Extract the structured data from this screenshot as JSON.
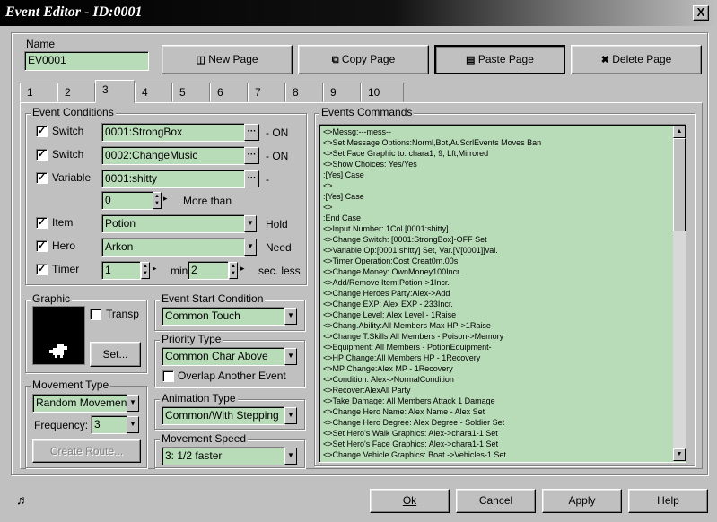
{
  "window": {
    "title": "Event Editor - ID:0001",
    "close_label": "X"
  },
  "name_field": {
    "label": "Name",
    "value": "EV0001"
  },
  "page_buttons": {
    "new_page": "New Page",
    "copy_page": "Copy Page",
    "paste_page": "Paste Page",
    "delete_page": "Delete Page"
  },
  "tabs": [
    "1",
    "2",
    "3",
    "4",
    "5",
    "6",
    "7",
    "8",
    "9",
    "10"
  ],
  "active_tab": "3",
  "event_conditions": {
    "label": "Event Conditions",
    "switch1": {
      "label": "Switch",
      "value": "0001:StrongBox",
      "suffix": "- ON"
    },
    "switch2": {
      "label": "Switch",
      "value": "0002:ChangeMusic",
      "suffix": "- ON"
    },
    "variable": {
      "label": "Variable",
      "value": "0001:shitty",
      "suffix": "-",
      "amount": "0",
      "compare": "More than"
    },
    "item": {
      "label": "Item",
      "value": "Potion",
      "suffix": "Hold"
    },
    "hero": {
      "label": "Hero",
      "value": "Arkon",
      "suffix": "Need"
    },
    "timer": {
      "label": "Timer",
      "value1": "1",
      "unit1": "min",
      "value2": "2",
      "suffix": "sec. less"
    }
  },
  "graphic": {
    "label": "Graphic",
    "transp_label": "Transp",
    "set_label": "Set..."
  },
  "event_start": {
    "label": "Event Start Condition",
    "value": "Common Touch"
  },
  "priority": {
    "label": "Priority Type",
    "value": "Common Char Above",
    "overlap_label": "Overlap Another Event"
  },
  "movement_type": {
    "label": "Movement Type",
    "value": "Random Movement",
    "frequency_label": "Frequency:",
    "frequency_value": "3",
    "create_route_label": "Create Route..."
  },
  "animation": {
    "label": "Animation Type",
    "value": "Common/With Stepping"
  },
  "movement_speed": {
    "label": "Movement Speed",
    "value": "3: 1/2 faster"
  },
  "commands": {
    "label": "Events Commands",
    "lines": [
      "<>Messg:---mess--",
      "<>Set Message Options:Norml,Bot,AuScrlEvents Moves Ban",
      "<>Set Face Graphic to:  chara1, 9, Lft,Mirrored",
      "<>Show Choices: Yes/Yes",
      ":[Yes] Case",
      "  <>",
      ":[Yes] Case",
      "  <>",
      ":End Case",
      "<>Input Number:   1Col.[0001:shitty]",
      "<>Change Switch:  [0001:StrongBox]-OFF Set",
      "<>Variable Op:[0001:shitty] Set, Var.[V[0001]]val.",
      "<>Timer Operation:Cost Creat0m.00s.",
      "<>Change Money: OwnMoney100Incr.",
      "<>Add/Remove Item:Potion->1Incr.",
      "<>Change Heroes Party:Alex->Add",
      "<>Change EXP:   Alex EXP -     233Incr.",
      "<>Change Level: Alex Level -   1Raise",
      "<>Chang.Ability:All Members   Max HP->1Raise",
      "<>Change T.Skills:All Members - Poison->Memory",
      "<>Equipment:  All Members - PotionEquipment-",
      "<>HP Change:All Members  HP - 1Recovery",
      "<>MP Change:Alex MP - 1Recovery",
      "<>Condition:   Alex->NormalCondition",
      "<>Recover:AlexAll Party",
      "<>Take Damage:    All Members Attack 1 Damage",
      "<>Change Hero Name: Alex Name - Alex Set",
      "<>Change Hero Degree: Alex Degree - Soldier Set",
      "<>Set Hero's Walk Graphics:     Alex->chara1-1 Set",
      "<>Set Hero's Face Graphics:     Alex->chara1-1 Set",
      "<>Change Vehicle Graphics:  Boat  ->Vehicles-1 Set"
    ]
  },
  "footer": {
    "ok": "Ok",
    "cancel": "Cancel",
    "apply": "Apply",
    "help": "Help"
  },
  "icons": {
    "status": "music-note-icon"
  },
  "colors": {
    "field_bg": "#b8dbb8",
    "dialog_bg": "#c0c0c0",
    "title_bg": "#000000"
  }
}
